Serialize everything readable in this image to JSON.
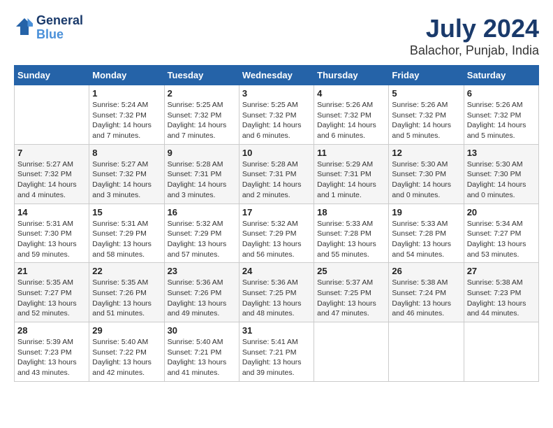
{
  "header": {
    "logo_line1": "General",
    "logo_line2": "Blue",
    "title": "July 2024",
    "subtitle": "Balachor, Punjab, India"
  },
  "days_of_week": [
    "Sunday",
    "Monday",
    "Tuesday",
    "Wednesday",
    "Thursday",
    "Friday",
    "Saturday"
  ],
  "weeks": [
    [
      {
        "day": "",
        "info": ""
      },
      {
        "day": "1",
        "info": "Sunrise: 5:24 AM\nSunset: 7:32 PM\nDaylight: 14 hours\nand 7 minutes."
      },
      {
        "day": "2",
        "info": "Sunrise: 5:25 AM\nSunset: 7:32 PM\nDaylight: 14 hours\nand 7 minutes."
      },
      {
        "day": "3",
        "info": "Sunrise: 5:25 AM\nSunset: 7:32 PM\nDaylight: 14 hours\nand 6 minutes."
      },
      {
        "day": "4",
        "info": "Sunrise: 5:26 AM\nSunset: 7:32 PM\nDaylight: 14 hours\nand 6 minutes."
      },
      {
        "day": "5",
        "info": "Sunrise: 5:26 AM\nSunset: 7:32 PM\nDaylight: 14 hours\nand 5 minutes."
      },
      {
        "day": "6",
        "info": "Sunrise: 5:26 AM\nSunset: 7:32 PM\nDaylight: 14 hours\nand 5 minutes."
      }
    ],
    [
      {
        "day": "7",
        "info": "Sunrise: 5:27 AM\nSunset: 7:32 PM\nDaylight: 14 hours\nand 4 minutes."
      },
      {
        "day": "8",
        "info": "Sunrise: 5:27 AM\nSunset: 7:32 PM\nDaylight: 14 hours\nand 3 minutes."
      },
      {
        "day": "9",
        "info": "Sunrise: 5:28 AM\nSunset: 7:31 PM\nDaylight: 14 hours\nand 3 minutes."
      },
      {
        "day": "10",
        "info": "Sunrise: 5:28 AM\nSunset: 7:31 PM\nDaylight: 14 hours\nand 2 minutes."
      },
      {
        "day": "11",
        "info": "Sunrise: 5:29 AM\nSunset: 7:31 PM\nDaylight: 14 hours\nand 1 minute."
      },
      {
        "day": "12",
        "info": "Sunrise: 5:30 AM\nSunset: 7:30 PM\nDaylight: 14 hours\nand 0 minutes."
      },
      {
        "day": "13",
        "info": "Sunrise: 5:30 AM\nSunset: 7:30 PM\nDaylight: 14 hours\nand 0 minutes."
      }
    ],
    [
      {
        "day": "14",
        "info": "Sunrise: 5:31 AM\nSunset: 7:30 PM\nDaylight: 13 hours\nand 59 minutes."
      },
      {
        "day": "15",
        "info": "Sunrise: 5:31 AM\nSunset: 7:29 PM\nDaylight: 13 hours\nand 58 minutes."
      },
      {
        "day": "16",
        "info": "Sunrise: 5:32 AM\nSunset: 7:29 PM\nDaylight: 13 hours\nand 57 minutes."
      },
      {
        "day": "17",
        "info": "Sunrise: 5:32 AM\nSunset: 7:29 PM\nDaylight: 13 hours\nand 56 minutes."
      },
      {
        "day": "18",
        "info": "Sunrise: 5:33 AM\nSunset: 7:28 PM\nDaylight: 13 hours\nand 55 minutes."
      },
      {
        "day": "19",
        "info": "Sunrise: 5:33 AM\nSunset: 7:28 PM\nDaylight: 13 hours\nand 54 minutes."
      },
      {
        "day": "20",
        "info": "Sunrise: 5:34 AM\nSunset: 7:27 PM\nDaylight: 13 hours\nand 53 minutes."
      }
    ],
    [
      {
        "day": "21",
        "info": "Sunrise: 5:35 AM\nSunset: 7:27 PM\nDaylight: 13 hours\nand 52 minutes."
      },
      {
        "day": "22",
        "info": "Sunrise: 5:35 AM\nSunset: 7:26 PM\nDaylight: 13 hours\nand 51 minutes."
      },
      {
        "day": "23",
        "info": "Sunrise: 5:36 AM\nSunset: 7:26 PM\nDaylight: 13 hours\nand 49 minutes."
      },
      {
        "day": "24",
        "info": "Sunrise: 5:36 AM\nSunset: 7:25 PM\nDaylight: 13 hours\nand 48 minutes."
      },
      {
        "day": "25",
        "info": "Sunrise: 5:37 AM\nSunset: 7:25 PM\nDaylight: 13 hours\nand 47 minutes."
      },
      {
        "day": "26",
        "info": "Sunrise: 5:38 AM\nSunset: 7:24 PM\nDaylight: 13 hours\nand 46 minutes."
      },
      {
        "day": "27",
        "info": "Sunrise: 5:38 AM\nSunset: 7:23 PM\nDaylight: 13 hours\nand 44 minutes."
      }
    ],
    [
      {
        "day": "28",
        "info": "Sunrise: 5:39 AM\nSunset: 7:23 PM\nDaylight: 13 hours\nand 43 minutes."
      },
      {
        "day": "29",
        "info": "Sunrise: 5:40 AM\nSunset: 7:22 PM\nDaylight: 13 hours\nand 42 minutes."
      },
      {
        "day": "30",
        "info": "Sunrise: 5:40 AM\nSunset: 7:21 PM\nDaylight: 13 hours\nand 41 minutes."
      },
      {
        "day": "31",
        "info": "Sunrise: 5:41 AM\nSunset: 7:21 PM\nDaylight: 13 hours\nand 39 minutes."
      },
      {
        "day": "",
        "info": ""
      },
      {
        "day": "",
        "info": ""
      },
      {
        "day": "",
        "info": ""
      }
    ]
  ]
}
